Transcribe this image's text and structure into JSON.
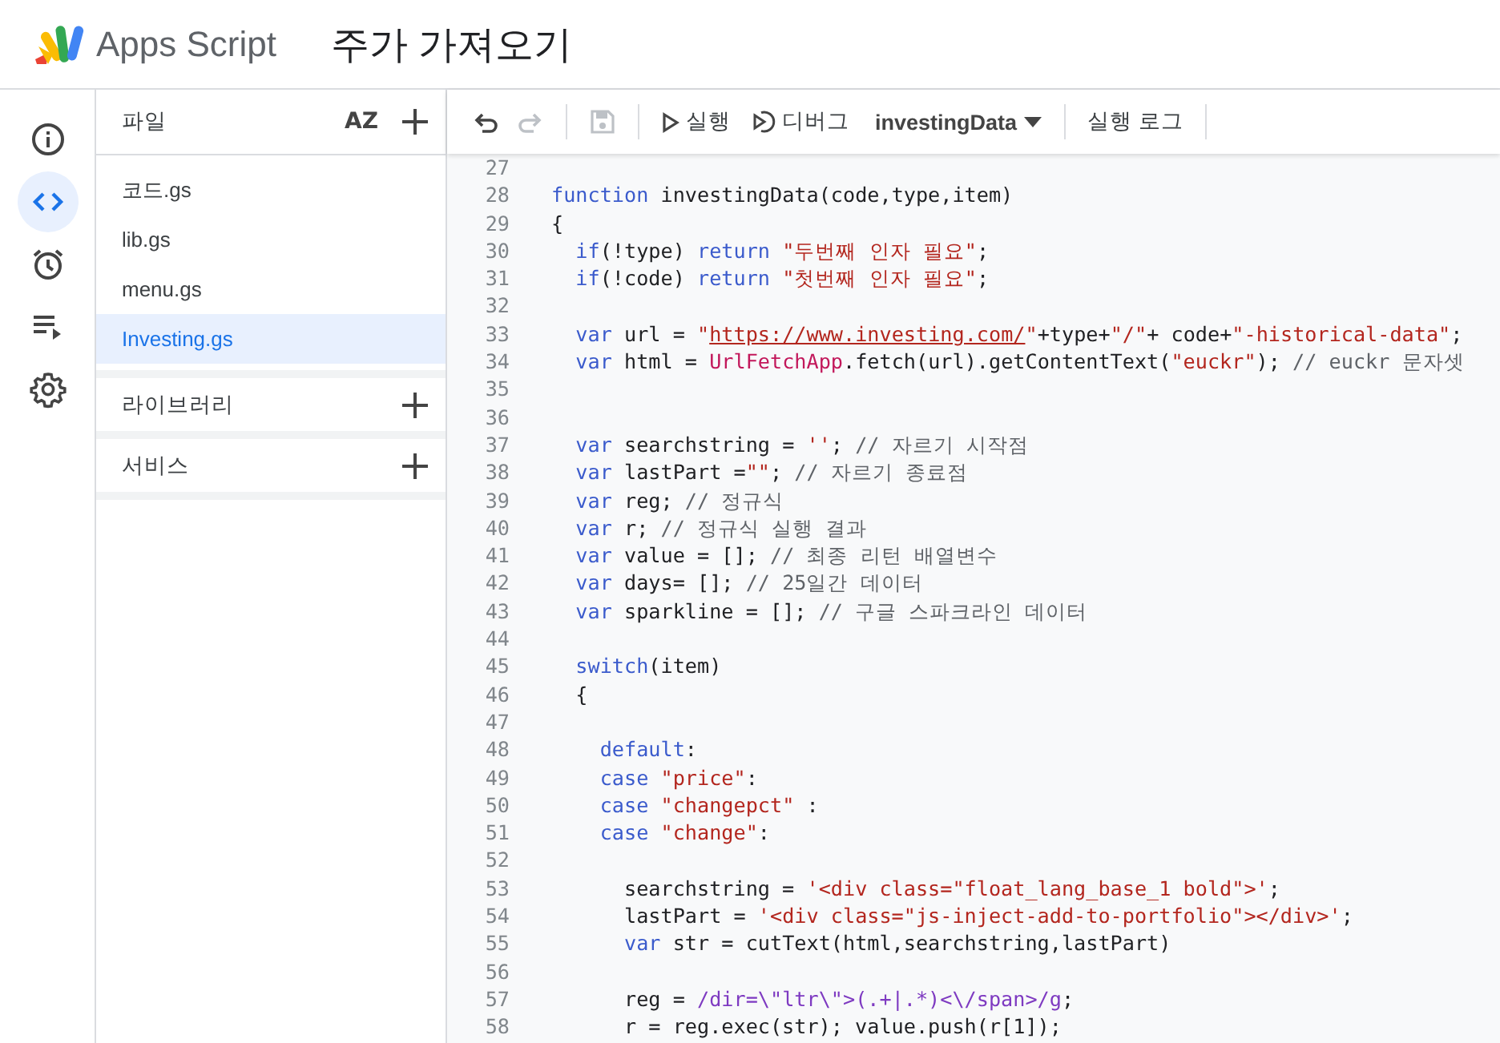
{
  "header": {
    "product": "Apps Script",
    "project_title": "주가 가져오기"
  },
  "rail": [
    {
      "kind": "info",
      "selected": false
    },
    {
      "kind": "code",
      "selected": true
    },
    {
      "kind": "clock",
      "selected": false
    },
    {
      "kind": "list",
      "selected": false
    },
    {
      "kind": "gear",
      "selected": false
    }
  ],
  "files_panel": {
    "title": "파일",
    "sort_label": "AZ",
    "files": [
      {
        "name": "코드.gs",
        "selected": false
      },
      {
        "name": "lib.gs",
        "selected": false
      },
      {
        "name": "menu.gs",
        "selected": false
      },
      {
        "name": "Investing.gs",
        "selected": true
      }
    ],
    "sections": [
      {
        "title": "라이브러리"
      },
      {
        "title": "서비스"
      }
    ]
  },
  "toolbar": {
    "undo": {
      "disabled": false
    },
    "redo": {
      "disabled": true
    },
    "save": {
      "disabled": true
    },
    "run": "실행",
    "debug": "디버그",
    "function": "investingData",
    "log": "실행 로그"
  },
  "editor": {
    "lines": [
      {
        "number": "27"
      },
      {
        "number": "28",
        "tokens": [
          {
            "kind": "kw",
            "text": "function"
          },
          {
            "kind": "plain",
            "text": " investingData(code,type,item)"
          }
        ]
      },
      {
        "number": "29",
        "tokens": [
          {
            "kind": "plain",
            "text": "{"
          }
        ]
      },
      {
        "number": "30",
        "tokens": [
          {
            "kind": "kw",
            "text": "  if"
          },
          {
            "kind": "plain",
            "text": "(!type) "
          },
          {
            "kind": "kw",
            "text": "return "
          },
          {
            "kind": "str",
            "text": "\"두번째 인자 필요\""
          },
          {
            "kind": "plain",
            "text": ";"
          }
        ]
      },
      {
        "number": "31",
        "tokens": [
          {
            "kind": "kw",
            "text": "  if"
          },
          {
            "kind": "plain",
            "text": "(!code) "
          },
          {
            "kind": "kw",
            "text": "return "
          },
          {
            "kind": "str",
            "text": "\"첫번째 인자 필요\""
          },
          {
            "kind": "plain",
            "text": ";"
          }
        ]
      },
      {
        "number": "32"
      },
      {
        "number": "33",
        "tokens": [
          {
            "kind": "kw",
            "text": "  var"
          },
          {
            "kind": "plain",
            "text": " url = "
          },
          {
            "kind": "str",
            "text": "\""
          },
          {
            "kind": "url",
            "text": "https://www.investing.com/"
          },
          {
            "kind": "str",
            "text": "\""
          },
          {
            "kind": "plain",
            "text": "+type+"
          },
          {
            "kind": "str",
            "text": "\"/\""
          },
          {
            "kind": "plain",
            "text": "+ code+"
          },
          {
            "kind": "str",
            "text": "\"-historical-data\""
          },
          {
            "kind": "plain",
            "text": ";"
          }
        ]
      },
      {
        "number": "34",
        "tokens": [
          {
            "kind": "kw",
            "text": "  var"
          },
          {
            "kind": "plain",
            "text": " html = "
          },
          {
            "kind": "fn",
            "text": "UrlFetchApp"
          },
          {
            "kind": "plain",
            "text": ".fetch(url).getContentText("
          },
          {
            "kind": "str",
            "text": "\"euckr\""
          },
          {
            "kind": "plain",
            "text": "); "
          },
          {
            "kind": "cm",
            "text": "// euckr 문자셋"
          }
        ]
      },
      {
        "number": "35"
      },
      {
        "number": "36"
      },
      {
        "number": "37",
        "tokens": [
          {
            "kind": "kw",
            "text": "  var"
          },
          {
            "kind": "plain",
            "text": " searchstring = "
          },
          {
            "kind": "str",
            "text": "''"
          },
          {
            "kind": "plain",
            "text": "; "
          },
          {
            "kind": "cm",
            "text": "// 자르기 시작점"
          }
        ]
      },
      {
        "number": "38",
        "tokens": [
          {
            "kind": "kw",
            "text": "  var"
          },
          {
            "kind": "plain",
            "text": " lastPart ="
          },
          {
            "kind": "str",
            "text": "\"\""
          },
          {
            "kind": "plain",
            "text": "; "
          },
          {
            "kind": "cm",
            "text": "// 자르기 종료점"
          }
        ]
      },
      {
        "number": "39",
        "tokens": [
          {
            "kind": "kw",
            "text": "  var"
          },
          {
            "kind": "plain",
            "text": " reg; "
          },
          {
            "kind": "cm",
            "text": "// 정규식"
          }
        ]
      },
      {
        "number": "40",
        "tokens": [
          {
            "kind": "kw",
            "text": "  var"
          },
          {
            "kind": "plain",
            "text": " r; "
          },
          {
            "kind": "cm",
            "text": "// 정규식 실행 결과"
          }
        ]
      },
      {
        "number": "41",
        "tokens": [
          {
            "kind": "kw",
            "text": "  var"
          },
          {
            "kind": "plain",
            "text": " value = []; "
          },
          {
            "kind": "cm",
            "text": "// 최종 리턴 배열변수"
          }
        ]
      },
      {
        "number": "42",
        "tokens": [
          {
            "kind": "kw",
            "text": "  var"
          },
          {
            "kind": "plain",
            "text": " days= []; "
          },
          {
            "kind": "cm",
            "text": "// 25일간 데이터"
          }
        ]
      },
      {
        "number": "43",
        "tokens": [
          {
            "kind": "kw",
            "text": "  var"
          },
          {
            "kind": "plain",
            "text": " sparkline = []; "
          },
          {
            "kind": "cm",
            "text": "// 구글 스파크라인 데이터"
          }
        ]
      },
      {
        "number": "44"
      },
      {
        "number": "45",
        "tokens": [
          {
            "kind": "kw",
            "text": "  switch"
          },
          {
            "kind": "plain",
            "text": "(item)"
          }
        ]
      },
      {
        "number": "46",
        "tokens": [
          {
            "kind": "plain",
            "text": "  {"
          }
        ]
      },
      {
        "number": "47"
      },
      {
        "number": "48",
        "tokens": [
          {
            "kind": "kw",
            "text": "    default"
          },
          {
            "kind": "plain",
            "text": ":"
          }
        ]
      },
      {
        "number": "49",
        "tokens": [
          {
            "kind": "kw",
            "text": "    case "
          },
          {
            "kind": "str",
            "text": "\"price\""
          },
          {
            "kind": "plain",
            "text": ":"
          }
        ]
      },
      {
        "number": "50",
        "tokens": [
          {
            "kind": "kw",
            "text": "    case "
          },
          {
            "kind": "str",
            "text": "\"changepct\""
          },
          {
            "kind": "plain",
            "text": " :"
          }
        ]
      },
      {
        "number": "51",
        "tokens": [
          {
            "kind": "kw",
            "text": "    case "
          },
          {
            "kind": "str",
            "text": "\"change\""
          },
          {
            "kind": "plain",
            "text": ":"
          }
        ]
      },
      {
        "number": "52"
      },
      {
        "number": "53",
        "tokens": [
          {
            "kind": "plain",
            "text": "      searchstring = "
          },
          {
            "kind": "str",
            "text": "'<div class=\"float_lang_base_1 bold\">'"
          },
          {
            "kind": "plain",
            "text": ";"
          }
        ]
      },
      {
        "number": "54",
        "tokens": [
          {
            "kind": "plain",
            "text": "      lastPart = "
          },
          {
            "kind": "str",
            "text": "'<div class=\"js-inject-add-to-portfolio\"></div>'"
          },
          {
            "kind": "plain",
            "text": ";"
          }
        ]
      },
      {
        "number": "55",
        "tokens": [
          {
            "kind": "kw",
            "text": "      var"
          },
          {
            "kind": "plain",
            "text": " str = cutText(html,searchstring,lastPart)"
          }
        ]
      },
      {
        "number": "56"
      },
      {
        "number": "57",
        "tokens": [
          {
            "kind": "plain",
            "text": "      reg = "
          },
          {
            "kind": "re",
            "text": "/dir=\\\"ltr\\\">(.+|.*)<\\/span>/g"
          },
          {
            "kind": "plain",
            "text": ";"
          }
        ]
      },
      {
        "number": "58",
        "tokens": [
          {
            "kind": "plain",
            "text": "      r = reg.exec(str); value.push(r[1]);"
          }
        ]
      }
    ]
  }
}
